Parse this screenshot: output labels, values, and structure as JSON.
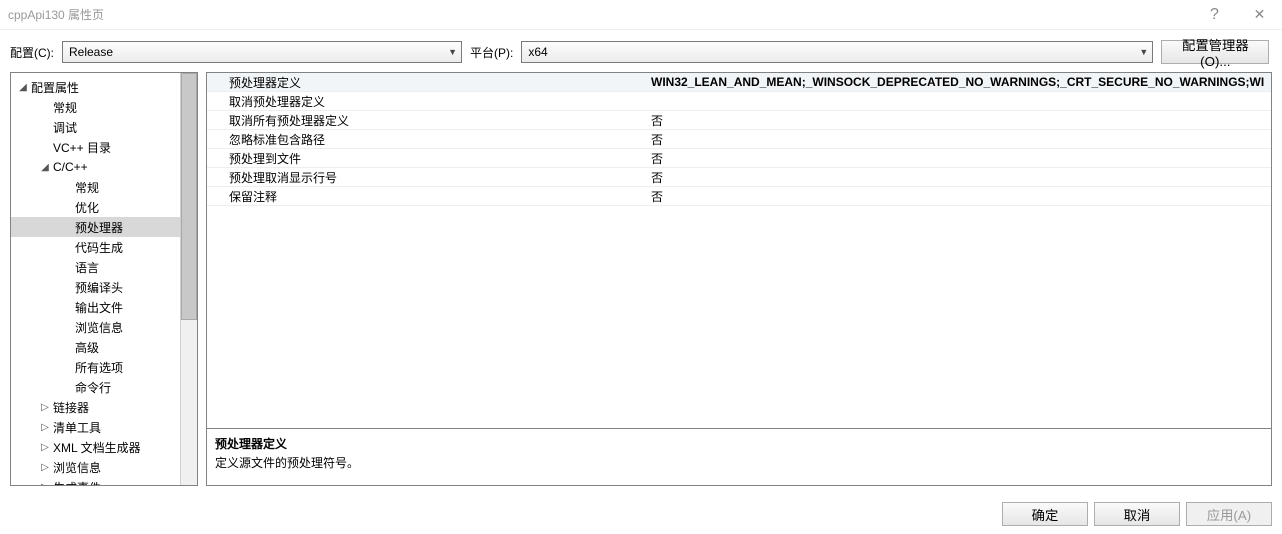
{
  "window": {
    "title": "cppApi130 属性页",
    "help": "?",
    "close": "✕"
  },
  "top": {
    "config_label": "配置(C):",
    "config_value": "Release",
    "platform_label": "平台(P):",
    "platform_value": "x64",
    "mgr_btn": "配置管理器(O)..."
  },
  "tree": [
    {
      "label": "配置属性",
      "depth": 0,
      "expander": "◢"
    },
    {
      "label": "常规",
      "depth": 1,
      "expander": ""
    },
    {
      "label": "调试",
      "depth": 1,
      "expander": ""
    },
    {
      "label": "VC++ 目录",
      "depth": 1,
      "expander": ""
    },
    {
      "label": "C/C++",
      "depth": 1,
      "expander": "◢"
    },
    {
      "label": "常规",
      "depth": 2,
      "expander": ""
    },
    {
      "label": "优化",
      "depth": 2,
      "expander": ""
    },
    {
      "label": "预处理器",
      "depth": 2,
      "expander": "",
      "selected": true
    },
    {
      "label": "代码生成",
      "depth": 2,
      "expander": ""
    },
    {
      "label": "语言",
      "depth": 2,
      "expander": ""
    },
    {
      "label": "预编译头",
      "depth": 2,
      "expander": ""
    },
    {
      "label": "输出文件",
      "depth": 2,
      "expander": ""
    },
    {
      "label": "浏览信息",
      "depth": 2,
      "expander": ""
    },
    {
      "label": "高级",
      "depth": 2,
      "expander": ""
    },
    {
      "label": "所有选项",
      "depth": 2,
      "expander": ""
    },
    {
      "label": "命令行",
      "depth": 2,
      "expander": ""
    },
    {
      "label": "链接器",
      "depth": 1,
      "expander": "▷"
    },
    {
      "label": "清单工具",
      "depth": 1,
      "expander": "▷"
    },
    {
      "label": "XML 文档生成器",
      "depth": 1,
      "expander": "▷"
    },
    {
      "label": "浏览信息",
      "depth": 1,
      "expander": "▷"
    },
    {
      "label": "生成事件",
      "depth": 1,
      "expander": "▷"
    }
  ],
  "grid": [
    {
      "label": "预处理器定义",
      "value": "WIN32_LEAN_AND_MEAN;_WINSOCK_DEPRECATED_NO_WARNINGS;_CRT_SECURE_NO_WARNINGS;WI",
      "bold": true,
      "selected": true
    },
    {
      "label": "取消预处理器定义",
      "value": ""
    },
    {
      "label": "取消所有预处理器定义",
      "value": "否"
    },
    {
      "label": "忽略标准包含路径",
      "value": "否"
    },
    {
      "label": "预处理到文件",
      "value": "否"
    },
    {
      "label": "预处理取消显示行号",
      "value": "否"
    },
    {
      "label": "保留注释",
      "value": "否"
    }
  ],
  "desc": {
    "title": "预处理器定义",
    "text": "定义源文件的预处理符号。"
  },
  "buttons": {
    "ok": "确定",
    "cancel": "取消",
    "apply": "应用(A)"
  }
}
